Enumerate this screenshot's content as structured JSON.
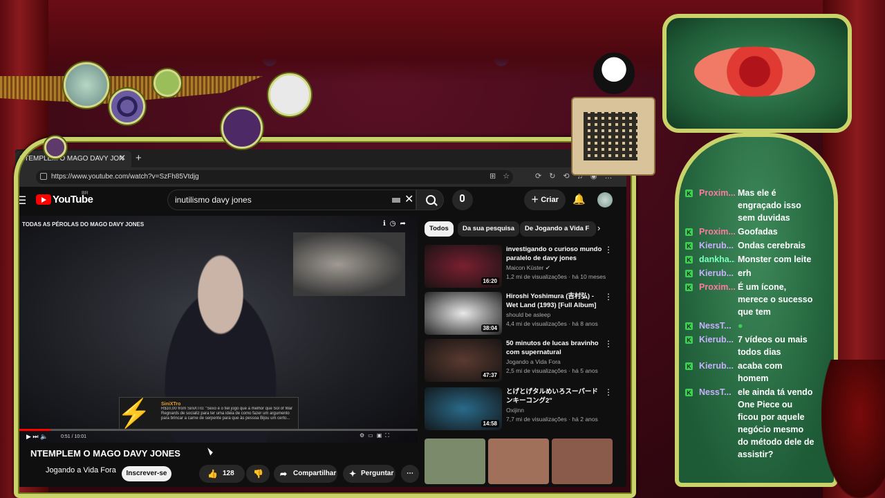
{
  "browser": {
    "tab_title": "NTEMPLEM O MAGO DAVY JON",
    "url": "https://www.youtube.com/watch?v=SzFh85Vtdjg"
  },
  "youtube": {
    "logo": "YouTube",
    "logo_region": "BR",
    "search_query": "inutilismo davy jones",
    "create_label": "Criar"
  },
  "player": {
    "overlay_title": "TODAS AS PÉROLAS DO MAGO DAVY JONES",
    "time": "0:51 / 10:01",
    "progress": 0.085,
    "donation_user": "SiniXTro",
    "donation_text": "R$10,00 from SiniXTro: \"Sexo é o fiel jogo que à melhor que Sol of War Regnards de socializ para ter uma ideia de como fazer um argumento para brincar a carne de serpente para que às pessoa Bijou um certo..."
  },
  "video": {
    "title": "NTEMPLEM O MAGO DAVY JONES",
    "channel": "Jogando a Vida Fora",
    "subscribe_label": "Inscrever-se",
    "likes": "128 mil",
    "share_label": "Compartilhar",
    "ask_label": "Perguntar"
  },
  "chips": [
    "Todos",
    "Da sua pesquisa",
    "De Jogando a Vida F"
  ],
  "recommendations": [
    {
      "title": "investigando o curioso mundo paralelo de davy jones",
      "channel": "Maicon Küster",
      "verified": true,
      "meta": "1,2 mi de visualizações · há 10 meses",
      "duration": "16:20",
      "thumb_color": "#7a2030"
    },
    {
      "title": "Hiroshi Yoshimura (吉村弘) - Wet Land (1993) [Full Album]",
      "channel": "should be asleep",
      "verified": false,
      "meta": "4,4 mi de visualizações · há 8 anos",
      "duration": "38:04",
      "thumb_color": "#e8e8e8"
    },
    {
      "title": "50 minutos de lucas bravinho com supernatural",
      "channel": "Jogando a Vida Fora",
      "verified": false,
      "meta": "2,5 mi de visualizações · há 5 anos",
      "duration": "47:37",
      "thumb_color": "#5a3a30"
    },
    {
      "title": "とげとげタルめいろスーパードンキーコング2\"",
      "channel": "Oxijinn",
      "verified": false,
      "meta": "7,7 mi de visualizações · há 2 anos",
      "duration": "14:58",
      "thumb_color": "#2a6a8a"
    }
  ],
  "chat": [
    {
      "user": "Proxim...",
      "color": "#ff7aa0",
      "msg": "Mas ele é engraçado isso sem duvidas"
    },
    {
      "user": "Proxim...",
      "color": "#ff7aa0",
      "msg": "Goofadas"
    },
    {
      "user": "Kierub...",
      "color": "#c9b0ff",
      "msg": "Ondas cerebrais"
    },
    {
      "user": "dankha...",
      "color": "#7affc0",
      "msg": "Monster com leite"
    },
    {
      "user": "Kierub...",
      "color": "#c9b0ff",
      "msg": "erh"
    },
    {
      "user": "Proxim...",
      "color": "#ff7aa0",
      "msg": "É um ícone, merece o sucesso que tem"
    },
    {
      "user": "NessT...",
      "color": "#c9b0ff",
      "msg": ""
    },
    {
      "user": "Kierub...",
      "color": "#c9b0ff",
      "msg": "7 vídeos ou mais todos dias"
    },
    {
      "user": "Kierub...",
      "color": "#c9b0ff",
      "msg": "acaba com homem"
    },
    {
      "user": "NessT...",
      "color": "#c9b0ff",
      "msg": "ele ainda tá vendo One Piece ou ficou por aquele negócio mesmo do método dele de assistir?"
    }
  ]
}
